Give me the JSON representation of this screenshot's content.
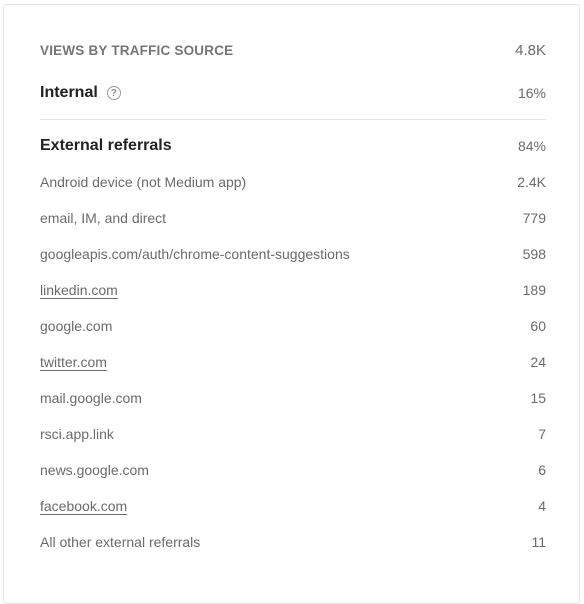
{
  "header": {
    "title": "VIEWS BY TRAFFIC SOURCE",
    "total": "4.8K"
  },
  "internal": {
    "label": "Internal",
    "help_icon": "question-circle-icon",
    "value": "16%"
  },
  "external": {
    "label": "External referrals",
    "value": "84%",
    "sources": [
      {
        "label": "Android device (not Medium app)",
        "value": "2.4K",
        "link": false
      },
      {
        "label": "email, IM, and direct",
        "value": "779",
        "link": false
      },
      {
        "label": "googleapis.com/auth/chrome-content-suggestions",
        "value": "598",
        "link": false
      },
      {
        "label": "linkedin.com",
        "value": "189",
        "link": true
      },
      {
        "label": "google.com",
        "value": "60",
        "link": false
      },
      {
        "label": "twitter.com",
        "value": "24",
        "link": true
      },
      {
        "label": "mail.google.com",
        "value": "15",
        "link": false
      },
      {
        "label": "rsci.app.link",
        "value": "7",
        "link": false
      },
      {
        "label": "news.google.com",
        "value": "6",
        "link": false
      },
      {
        "label": "facebook.com",
        "value": "4",
        "link": true
      },
      {
        "label": "All other external referrals",
        "value": "11",
        "link": false
      }
    ]
  },
  "colors": {
    "text_primary": "#222222",
    "text_secondary": "#6b6b6b",
    "divider": "#e3e3e3"
  }
}
